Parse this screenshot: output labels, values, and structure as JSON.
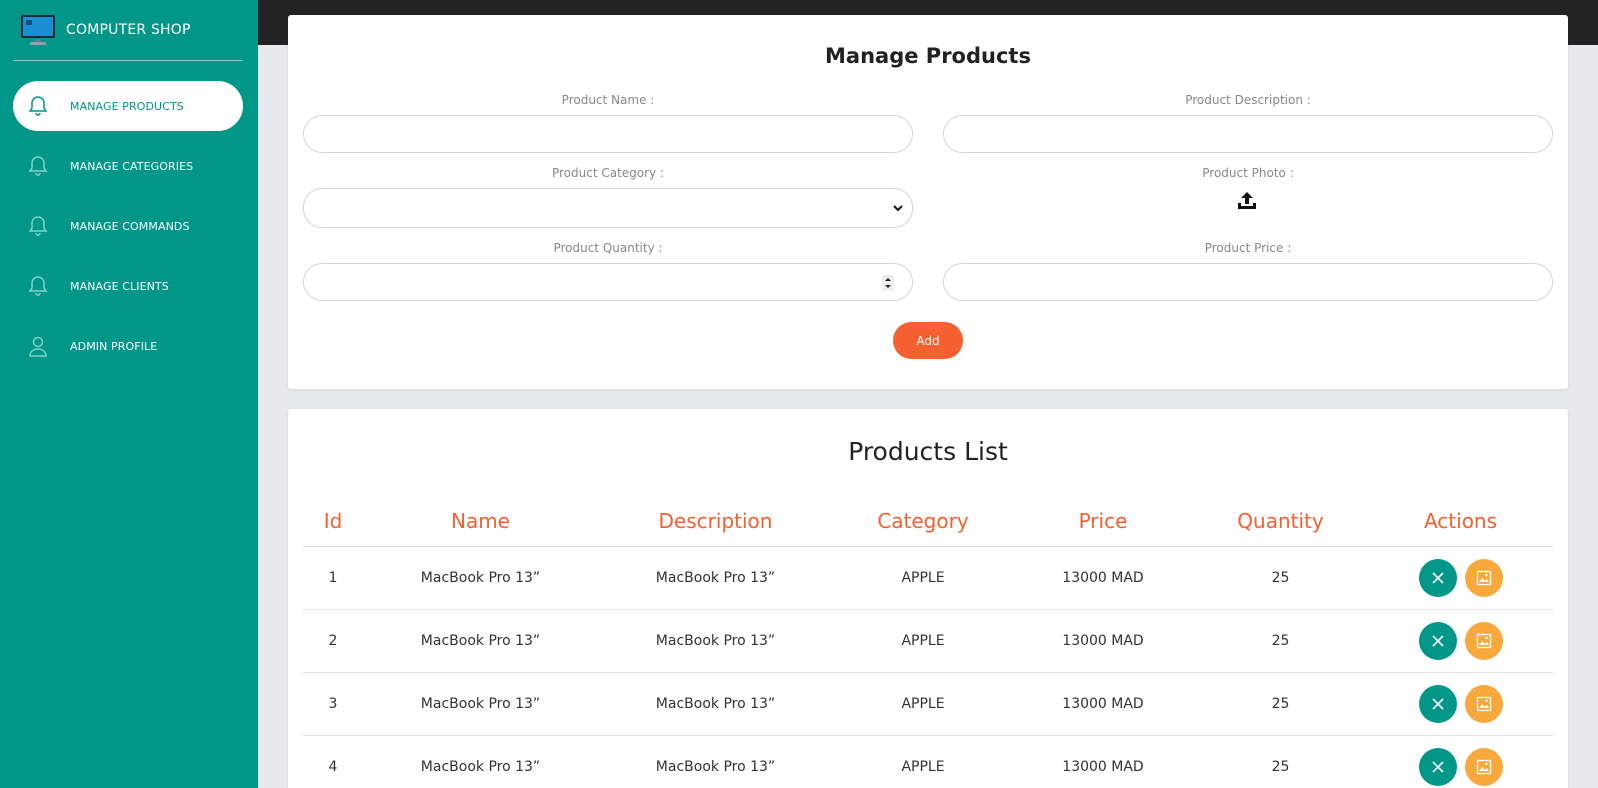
{
  "brand": {
    "name": "COMPUTER SHOP",
    "logo_icon": "monitor-icon"
  },
  "sidebar": {
    "items": [
      {
        "label": "MANAGE PRODUCTS",
        "icon": "bell-icon",
        "active": true
      },
      {
        "label": "MANAGE CATEGORIES",
        "icon": "bell-icon",
        "active": false
      },
      {
        "label": "MANAGE COMMANDS",
        "icon": "bell-icon",
        "active": false
      },
      {
        "label": "MANAGE CLIENTS",
        "icon": "bell-icon",
        "active": false
      },
      {
        "label": "ADMIN PROFILE",
        "icon": "user-icon",
        "active": false
      }
    ]
  },
  "form": {
    "title": "Manage Products",
    "product_name_label": "Product Name :",
    "product_name_value": "",
    "product_description_label": "Product Description :",
    "product_description_value": "",
    "product_category_label": "Product Category :",
    "product_category_value": "",
    "product_photo_label": "Product Photo :",
    "product_quantity_label": "Product Quantity :",
    "product_quantity_value": "",
    "product_price_label": "Product Price :",
    "product_price_value": "",
    "add_label": "Add"
  },
  "list": {
    "title": "Products List",
    "columns": [
      "Id",
      "Name",
      "Description",
      "Category",
      "Price",
      "Quantity",
      "Actions"
    ],
    "rows": [
      {
        "id": "1",
        "name": "MacBook Pro 13”",
        "description": "MacBook Pro 13”",
        "category": "APPLE",
        "price": "13000 MAD",
        "quantity": "25"
      },
      {
        "id": "2",
        "name": "MacBook Pro 13”",
        "description": "MacBook Pro 13”",
        "category": "APPLE",
        "price": "13000 MAD",
        "quantity": "25"
      },
      {
        "id": "3",
        "name": "MacBook Pro 13”",
        "description": "MacBook Pro 13”",
        "category": "APPLE",
        "price": "13000 MAD",
        "quantity": "25"
      },
      {
        "id": "4",
        "name": "MacBook Pro 13”",
        "description": "MacBook Pro 13”",
        "category": "APPLE",
        "price": "13000 MAD",
        "quantity": "25"
      }
    ]
  },
  "colors": {
    "sidebar": "#009688",
    "accent": "#f4602f",
    "delete": "#009688",
    "image": "#f9a93c",
    "topbar": "#232323"
  }
}
